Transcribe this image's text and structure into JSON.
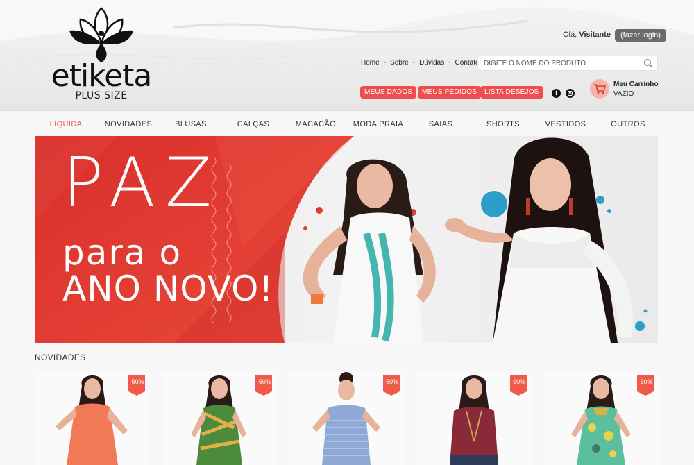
{
  "header": {
    "logo_word": "etiketa",
    "logo_sub": "PLUS SIZE",
    "greeting_prefix": "Olá,",
    "greeting_name": "Visitante",
    "login_label": "(fazer login)",
    "top_links": [
      "Home",
      "Sobre",
      "Dúvidas",
      "Contato"
    ],
    "search_placeholder": "DIGITE O NOME DO PRODUTO...",
    "buttons": {
      "meus_dados": "MEUS DADOS",
      "meus_pedidos": "MEUS PEDIDOS",
      "lista_desejos": "LISTA DESEJOS"
    },
    "social": [
      "facebook-icon",
      "instagram-icon"
    ],
    "cart_title": "Meu Carrinho",
    "cart_status": "VAZIO"
  },
  "nav": {
    "items": [
      "LIQUIDA",
      "NOVIDADES",
      "BLUSAS",
      "CALÇAS",
      "MACACÃO",
      "MODA PRAIA",
      "SAIAS",
      "SHORTS",
      "VESTIDOS",
      "OUTROS"
    ],
    "active": "LIQUIDA"
  },
  "banner": {
    "line1": "PAZ",
    "line2": "para o",
    "line3": "ANO NOVO!"
  },
  "section": {
    "title": "NOVIDADES"
  },
  "products": [
    {
      "badge": "-50%",
      "outfit_color": "#f07a55"
    },
    {
      "badge": "-50%",
      "outfit_color": "#4c8a3c"
    },
    {
      "badge": "-50%",
      "outfit_color": "#8ea9d6"
    },
    {
      "badge": "-50%",
      "outfit_color": "#8a2a38"
    },
    {
      "badge": "-50%",
      "outfit_color": "#5bbf9e"
    }
  ],
  "colors": {
    "accent": "#f05a4a",
    "button": "#f04e4e",
    "banner_red": "#e23a32"
  }
}
